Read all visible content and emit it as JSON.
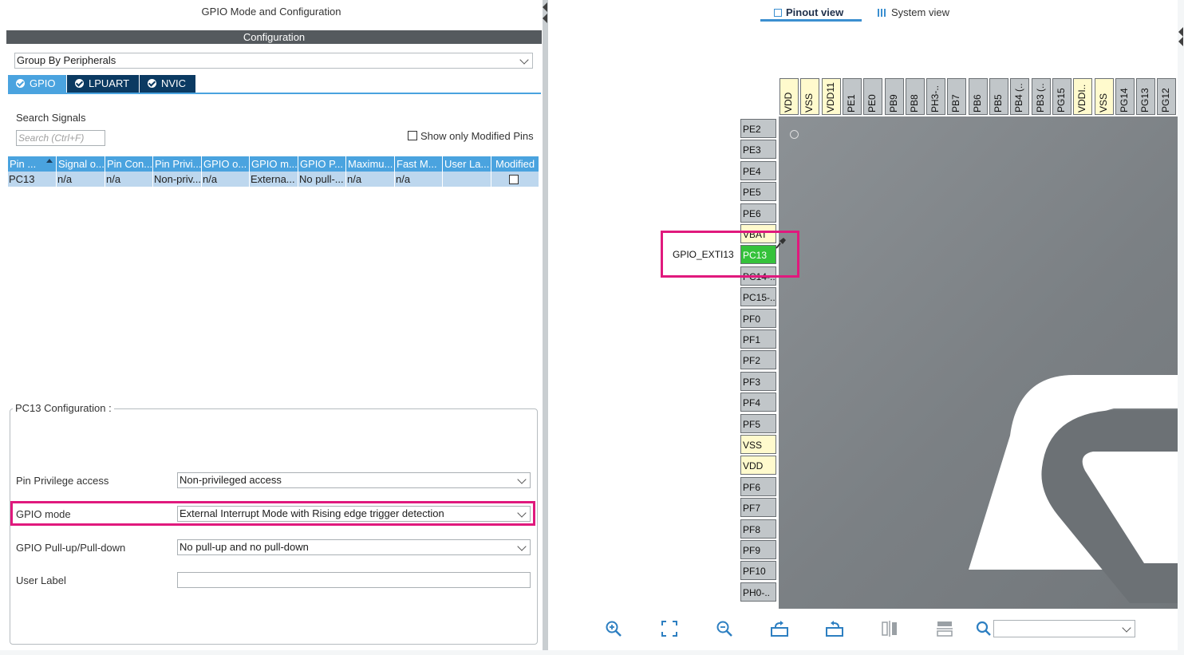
{
  "left_panel": {
    "title": "GPIO Mode and Configuration",
    "config_header": "Configuration",
    "group_by": "Group By Peripherals",
    "tabs": [
      {
        "label": "GPIO",
        "active": true
      },
      {
        "label": "LPUART",
        "active": false
      },
      {
        "label": "NVIC",
        "active": false
      }
    ],
    "search": {
      "label": "Search Signals",
      "placeholder": "Search (Ctrl+F)"
    },
    "show_modified_label": "Show only Modified Pins",
    "table": {
      "headers": [
        "Pin ...",
        "Signal o...",
        "Pin Con...",
        "Pin Privi...",
        "GPIO o...",
        "GPIO m...",
        "GPIO P...",
        "Maximu...",
        "Fast M...",
        "User La...",
        "Modified"
      ],
      "rows": [
        [
          "PC13",
          "n/a",
          "n/a",
          "Non-priv...",
          "n/a",
          "Externa...",
          "No pull-...",
          "n/a",
          "n/a",
          "",
          ""
        ]
      ]
    },
    "pc13_config": {
      "title": "PC13 Configuration :",
      "pin_privilege_label": "Pin Privilege access",
      "pin_privilege_value": "Non-privileged access",
      "gpio_mode_label": "GPIO mode",
      "gpio_mode_value": "External Interrupt Mode with Rising edge trigger detection",
      "pull_label": "GPIO Pull-up/Pull-down",
      "pull_value": "No pull-up and no pull-down",
      "user_label_label": "User Label",
      "user_label_value": ""
    }
  },
  "right_panel": {
    "pinout_tab": "Pinout view",
    "system_tab": "System view",
    "signal_label": "GPIO_EXTI13",
    "left_pins": [
      {
        "name": "PE2",
        "kind": "normal"
      },
      {
        "name": "PE3",
        "kind": "normal"
      },
      {
        "name": "PE4",
        "kind": "normal"
      },
      {
        "name": "PE5",
        "kind": "normal"
      },
      {
        "name": "PE6",
        "kind": "normal"
      },
      {
        "name": "VBAT",
        "kind": "power"
      },
      {
        "name": "PC13",
        "kind": "active"
      },
      {
        "name": "PC14-..",
        "kind": "normal"
      },
      {
        "name": "PC15-..",
        "kind": "normal"
      },
      {
        "name": "PF0",
        "kind": "normal"
      },
      {
        "name": "PF1",
        "kind": "normal"
      },
      {
        "name": "PF2",
        "kind": "normal"
      },
      {
        "name": "PF3",
        "kind": "normal"
      },
      {
        "name": "PF4",
        "kind": "normal"
      },
      {
        "name": "PF5",
        "kind": "normal"
      },
      {
        "name": "VSS",
        "kind": "power"
      },
      {
        "name": "VDD",
        "kind": "power"
      },
      {
        "name": "PF6",
        "kind": "normal"
      },
      {
        "name": "PF7",
        "kind": "normal"
      },
      {
        "name": "PF8",
        "kind": "normal"
      },
      {
        "name": "PF9",
        "kind": "normal"
      },
      {
        "name": "PF10",
        "kind": "normal"
      },
      {
        "name": "PH0-..",
        "kind": "normal"
      }
    ],
    "top_pins": [
      {
        "name": "VDD",
        "kind": "power"
      },
      {
        "name": "VSS",
        "kind": "power"
      },
      {
        "name": "VDD11",
        "kind": "power"
      },
      {
        "name": "PE1",
        "kind": "normal"
      },
      {
        "name": "PE0",
        "kind": "normal"
      },
      {
        "name": "PB9",
        "kind": "normal"
      },
      {
        "name": "PB8",
        "kind": "normal"
      },
      {
        "name": "PH3-..",
        "kind": "normal"
      },
      {
        "name": "PB7",
        "kind": "normal"
      },
      {
        "name": "PB6",
        "kind": "normal"
      },
      {
        "name": "PB5",
        "kind": "normal"
      },
      {
        "name": "PB4 (..",
        "kind": "normal"
      },
      {
        "name": "PB3 (..",
        "kind": "normal"
      },
      {
        "name": "PG15",
        "kind": "normal"
      },
      {
        "name": "VDDI..",
        "kind": "power"
      },
      {
        "name": "VSS",
        "kind": "power"
      },
      {
        "name": "PG14",
        "kind": "normal"
      },
      {
        "name": "PG13",
        "kind": "normal"
      },
      {
        "name": "PG12",
        "kind": "normal"
      }
    ],
    "toolbar_icons": [
      "zoom-in-icon",
      "fit-screen-icon",
      "zoom-out-icon",
      "rotate-right-icon",
      "rotate-left-icon",
      "flip-horizontal-icon",
      "flip-vertical-icon",
      "search-icon"
    ],
    "zoom_select_value": ""
  },
  "colors": {
    "tab_active": "#4aa3df",
    "tab_inactive": "#0b3a62",
    "highlight": "#e0197d",
    "pin_active": "#35c23b",
    "pin_power": "#fffacd",
    "pin_normal": "#c1c6c9"
  }
}
